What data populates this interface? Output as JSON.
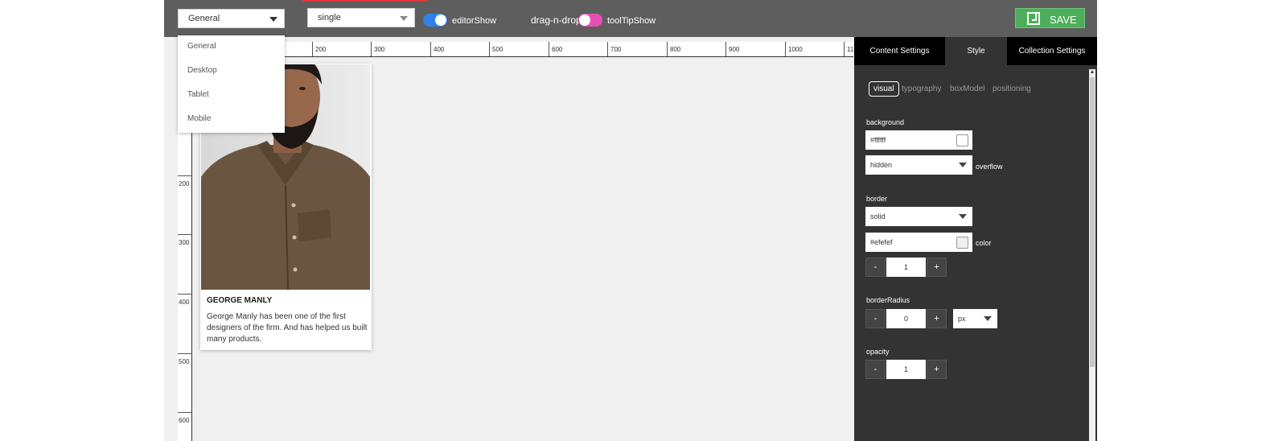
{
  "toolbar": {
    "device_select": "General",
    "mode_select": "single",
    "editor_show_label": "editorShow",
    "drag_n_drop_label": "drag-n-drop",
    "tooltip_show_label": "toolTipShow",
    "save_label": "SAVE",
    "editor_show_on": true,
    "tooltip_show_on": true
  },
  "device_dropdown": {
    "items": [
      "General",
      "Desktop",
      "Tablet",
      "Mobile"
    ]
  },
  "rulers": {
    "top": [
      "200",
      "300",
      "400",
      "500",
      "600",
      "700",
      "800",
      "900",
      "1000",
      "11"
    ],
    "left": [
      "200",
      "300",
      "400",
      "500",
      "600"
    ]
  },
  "card": {
    "title": "GEORGE MANLY",
    "text": "George Manly has been one of the first designers of the firm. And has helped us built many products."
  },
  "panel": {
    "tabs": [
      "Content Settings",
      "Style",
      "Collection Settings"
    ],
    "active_tab": "Style",
    "subtabs": [
      "visual",
      "typography",
      "boxModel",
      "positioning"
    ],
    "active_subtab": "visual",
    "background": {
      "label": "background",
      "color": "#ffffff",
      "overflow_value": "hidden",
      "overflow_label": "overflow"
    },
    "border": {
      "label": "border",
      "style_value": "solid",
      "color": "#efefef",
      "color_label": "color",
      "width": "1"
    },
    "border_radius": {
      "label": "borderRadius",
      "value": "0",
      "unit": "px"
    },
    "opacity": {
      "label": "opacity",
      "value": "1"
    },
    "minus": "-",
    "plus": "+"
  },
  "colors": {
    "toolbar": "#5e5e5e",
    "save_button": "#4cae5b",
    "editor_toggle": "#2f80ed",
    "tooltip_toggle": "#e84fb5",
    "panel": "#333333",
    "panel_tabs": "#000000"
  }
}
